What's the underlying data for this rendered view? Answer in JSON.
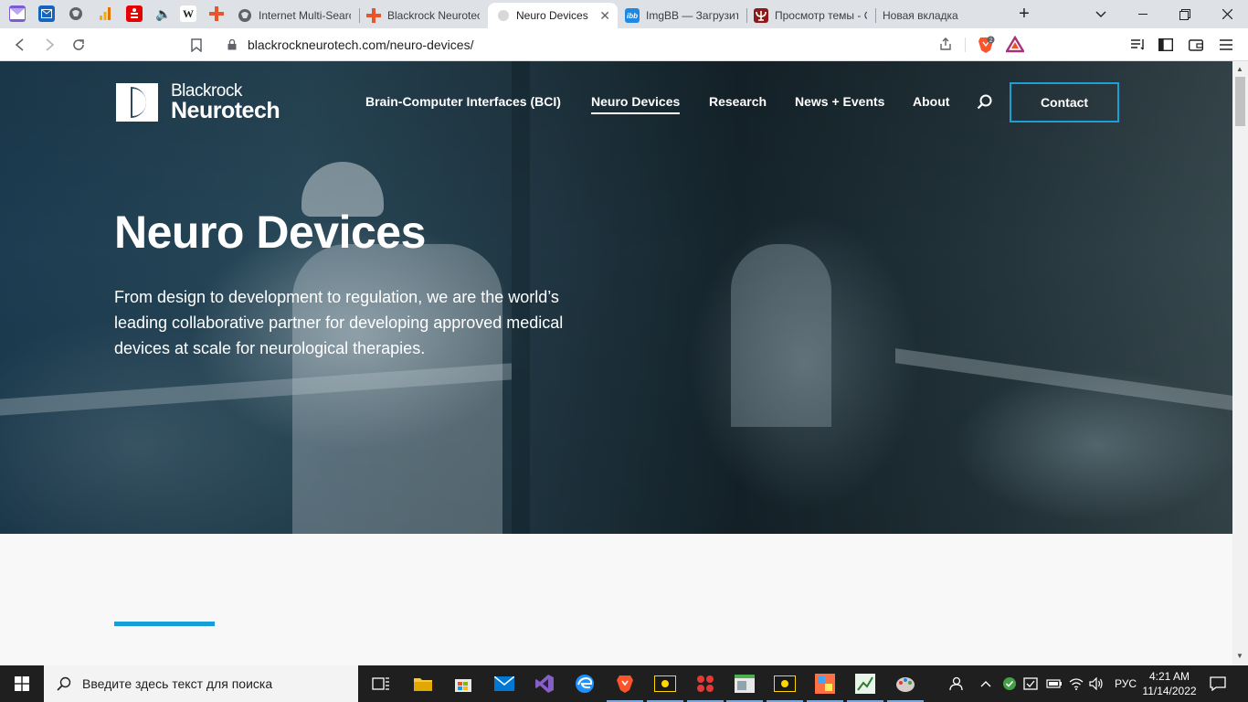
{
  "browser": {
    "tabs": [
      {
        "label": "Internet Multi-Searc",
        "icon": "globe-icon"
      },
      {
        "label": "Blackrock Neurotec",
        "icon": "red-cross-icon"
      },
      {
        "label": "Neuro Devices",
        "icon": "blackrock-logo-icon",
        "active": true
      },
      {
        "label": "ImgBB — Загрузить",
        "icon": "imgbb-icon"
      },
      {
        "label": "Просмотр темы - С",
        "icon": "psi-icon"
      },
      {
        "label": "Новая вкладка",
        "icon": "none"
      }
    ],
    "pinned_icon_letters": {
      "wiki": "W",
      "ibb": "ibb"
    },
    "new_tab_symbol": "+",
    "url": "blackrockneurotech.com/neuro-devices/",
    "brave_badge": "2",
    "colors": {
      "tabstrip": "#dee1e6",
      "accent": "#fb542b"
    }
  },
  "site": {
    "logo": {
      "line1": "Blackrock",
      "line2": "Neurotech"
    },
    "nav": [
      "Brain-Computer Interfaces (BCI)",
      "Neuro Devices",
      "Research",
      "News + Events",
      "About"
    ],
    "active_nav": "Neuro Devices",
    "contact_label": "Contact",
    "hero_title": "Neuro Devices",
    "hero_subtitle": "From design to development to regulation, we are the world’s leading collaborative partner for developing approved medical devices at scale for neurological therapies.",
    "colors": {
      "accent_blue": "#159ed9",
      "contact_border": "#1a9fd6"
    }
  },
  "taskbar": {
    "search_placeholder": "Введите здесь текст для поиска",
    "lang": "РУС",
    "time": "4:21 AM",
    "date": "11/14/2022"
  }
}
